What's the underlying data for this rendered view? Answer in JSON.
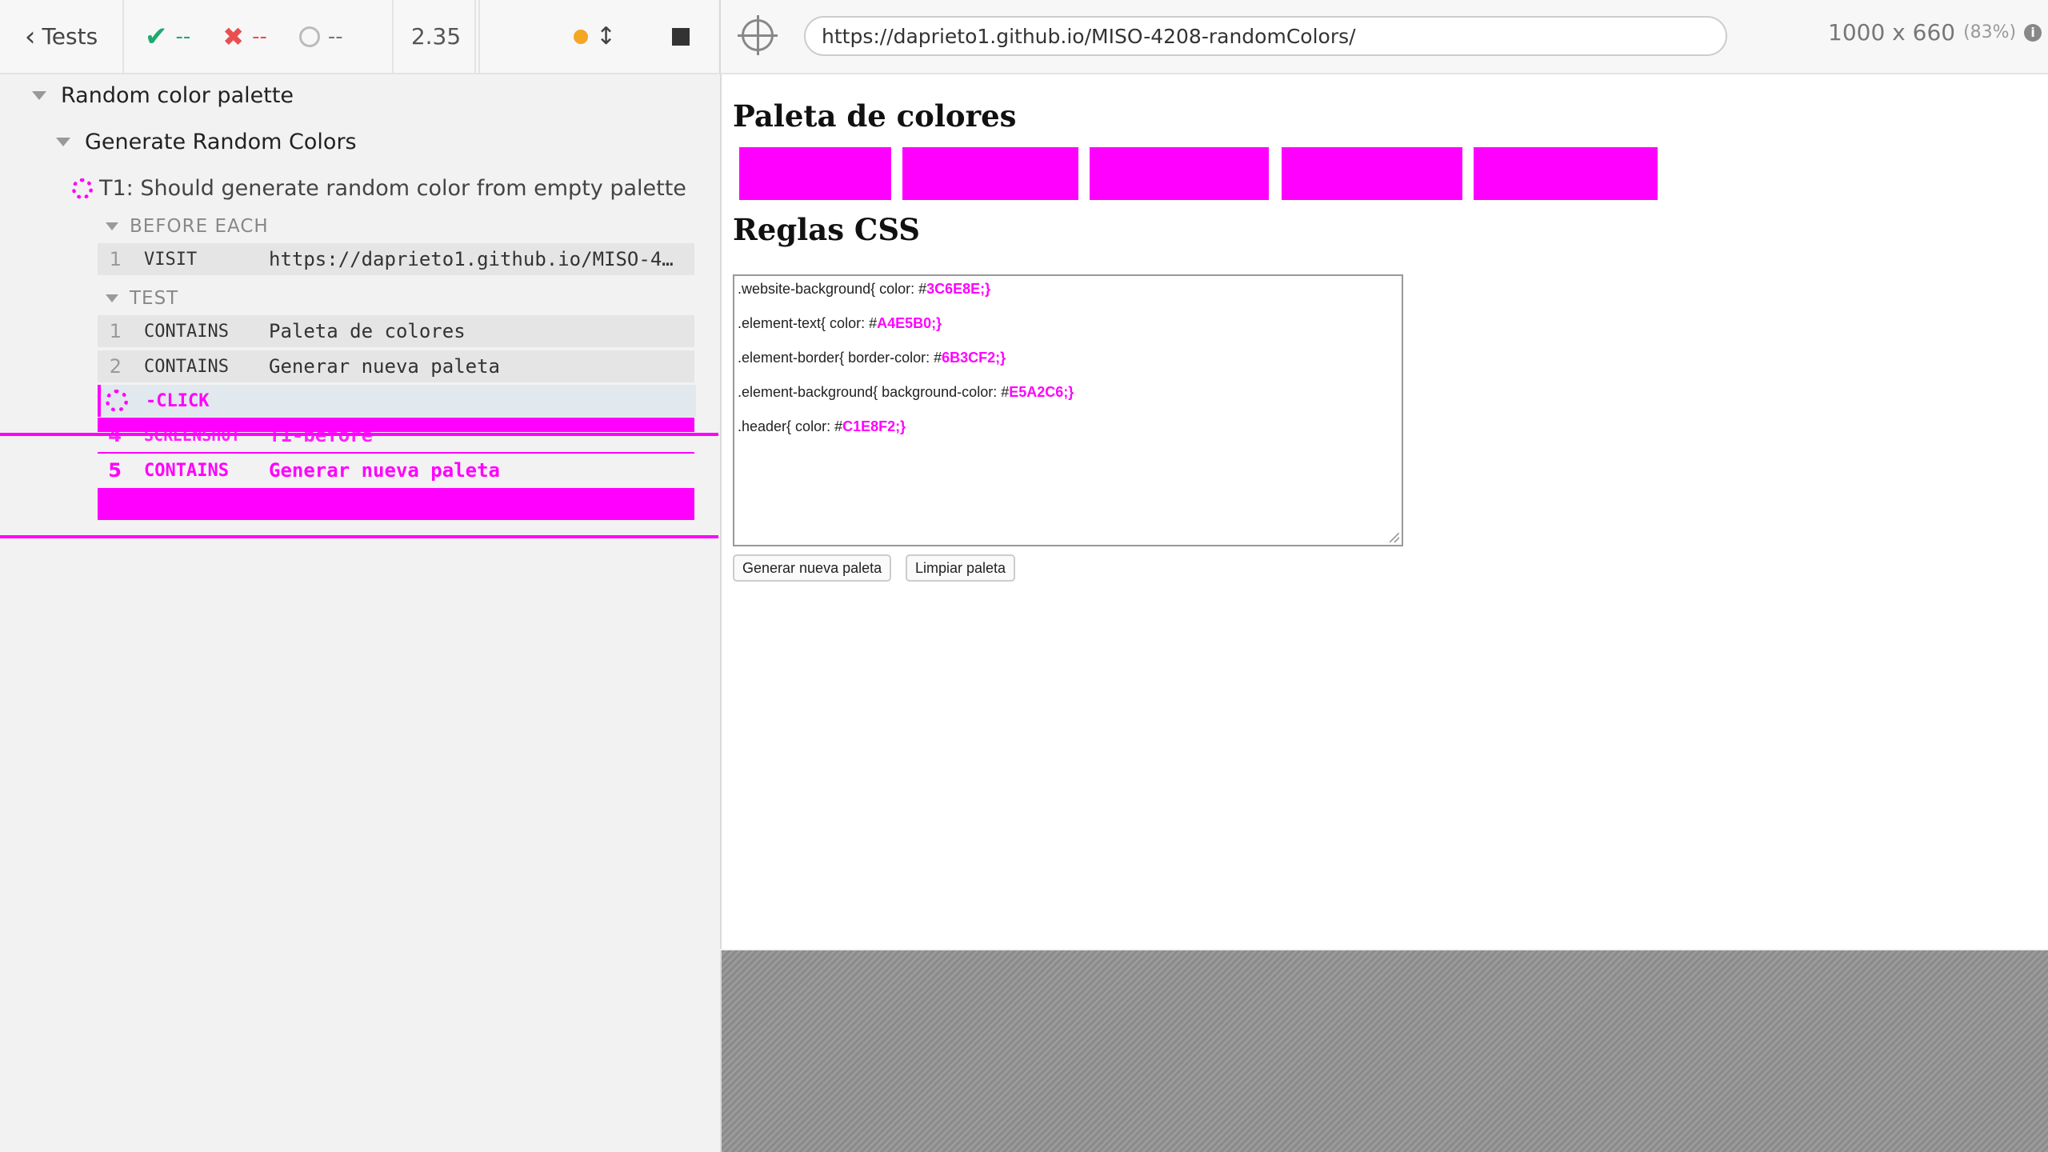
{
  "header": {
    "back_label": "Tests",
    "passed": "--",
    "failed": "--",
    "pending": "--",
    "duration": "2.35",
    "url": "https://daprieto1.github.io/MISO-4208-randomColors/",
    "viewport": "1000 x 660",
    "zoom": "(83%)"
  },
  "tree": {
    "suite": "Random color palette",
    "describe": "Generate Random Colors",
    "test": "T1: Should generate random color from empty palette",
    "before_each_label": "BEFORE EACH",
    "test_label": "TEST",
    "before_each_cmds": [
      {
        "num": "1",
        "name": "VISIT",
        "arg": "https://daprieto1.github.io/MISO-4…"
      }
    ],
    "test_cmds": [
      {
        "num": "1",
        "name": "CONTAINS",
        "arg": "Paleta de colores"
      },
      {
        "num": "2",
        "name": "CONTAINS",
        "arg": "Generar nueva paleta"
      },
      {
        "num": "",
        "name": "-CLICK",
        "arg": ""
      },
      {
        "num": "4",
        "name": "SCREENSHOT",
        "arg": "T1-before"
      },
      {
        "num": "5",
        "name": "CONTAINS",
        "arg": "Generar nueva paleta"
      }
    ]
  },
  "app": {
    "title": "Paleta de colores",
    "css_title": "Reglas CSS",
    "swatch_color": "#ff00ff",
    "rules": [
      {
        "prefix": ".website-background{ color: #",
        "hex": "3C6E8E;}"
      },
      {
        "prefix": ".element-text{ color: #",
        "hex": "A4E5B0;}"
      },
      {
        "prefix": ".element-border{ border-color: #",
        "hex": "6B3CF2;}"
      },
      {
        "prefix": ".element-background{ background-color: #",
        "hex": "E5A2C6;}"
      },
      {
        "prefix": ".header{ color: #",
        "hex": "C1E8F2;}"
      }
    ],
    "generate_button": "Generar nueva paleta",
    "clear_button": "Limpiar paleta"
  }
}
